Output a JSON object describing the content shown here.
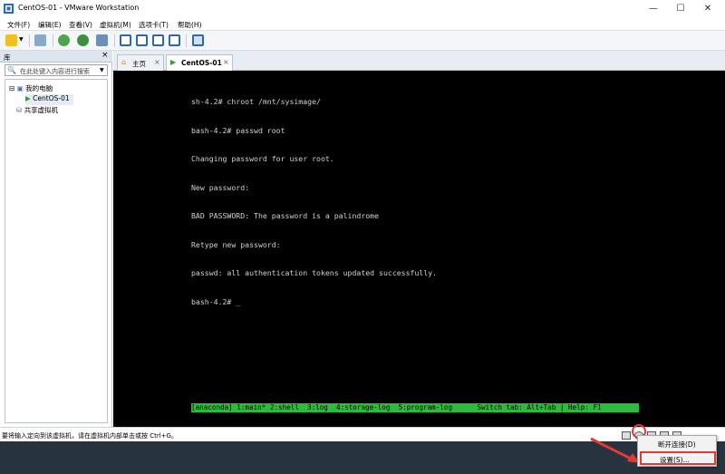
{
  "window": {
    "title": "CentOS-01 - VMware Workstation",
    "minimize": "—",
    "maximize": "☐",
    "close": "✕"
  },
  "menu": [
    "文件(F)",
    "编辑(E)",
    "查看(V)",
    "虚拟机(M)",
    "选项卡(T)",
    "帮助(H)"
  ],
  "library": {
    "title": "库",
    "close": "×",
    "search_placeholder": "在此处键入内容进行搜索",
    "tree": [
      {
        "label": "我的电脑",
        "expander": "⊟"
      },
      {
        "label": "CentOS-01"
      },
      {
        "label": "共享虚拟机"
      }
    ]
  },
  "tabs": [
    {
      "label": "主页",
      "close": "×"
    },
    {
      "label": "CentOS-01",
      "close": "×"
    }
  ],
  "terminal": {
    "lines": [
      "sh-4.2# chroot /mnt/sysimage/",
      "bash-4.2# passwd root",
      "Changing password for user root.",
      "New password:",
      "BAD PASSWORD: The password is a palindrome",
      "Retype new password:",
      "passwd: all authentication tokens updated successfully.",
      "bash-4.2# _"
    ],
    "status_line": "[anaconda] 1:main* 2:shell  3:log  4:storage-log  5:program-log      Switch tab: Alt+Tab | Help: F1"
  },
  "statusbar": {
    "text": "要将输入定向到该虚拟机，请在虚拟机内部单击或按 Ctrl+G。"
  },
  "context_menu": {
    "items": [
      "断开连接(D)",
      "设置(S)..."
    ]
  },
  "colors": {
    "accent_red": "#e53935",
    "tmux_green": "#2dbb3c",
    "taskbar": "#27343f"
  }
}
